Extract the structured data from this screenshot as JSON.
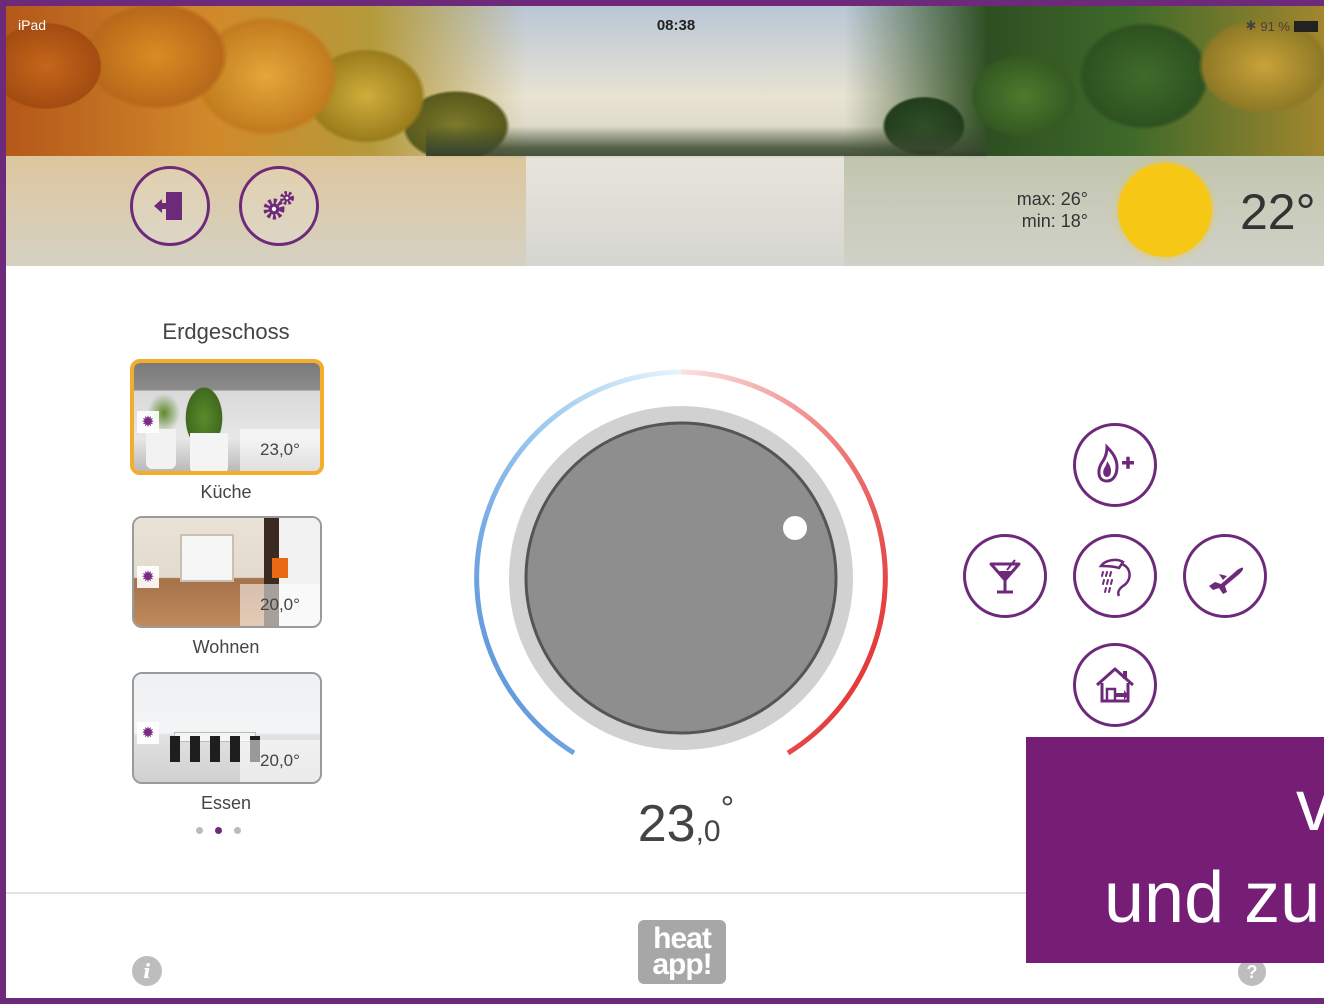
{
  "status_bar": {
    "carrier": "iPad",
    "time": "08:38",
    "battery": "91 %"
  },
  "header": {
    "weather_max": "max: 26°",
    "weather_min": "min: 18°",
    "current_temp": "22°",
    "colors": {
      "accent": "#6e2a7a",
      "sun": "#f6c715"
    }
  },
  "floor": {
    "title": "Erdgeschoss",
    "rooms": [
      {
        "name": "Küche",
        "temp": "23,0°",
        "active": true
      },
      {
        "name": "Wohnen",
        "temp": "20,0°",
        "active": false
      },
      {
        "name": "Essen",
        "temp": "20,0°",
        "active": false
      }
    ],
    "page_dots": 3,
    "current_page": 2
  },
  "dial": {
    "setpoint_main": "23",
    "setpoint_decimal": ",0",
    "setpoint_degree": "°"
  },
  "modes": {
    "boost": "flame-plus-icon",
    "party": "cocktail-icon",
    "shower": "shower-icon",
    "vacation": "airplane-icon",
    "away": "house-leave-icon"
  },
  "footer": {
    "logo_line1": "heat",
    "logo_line2": "app!",
    "info": "i",
    "help": "?"
  },
  "banner": {
    "line1": "v",
    "line2": "und zu",
    "color": "#761e75"
  }
}
